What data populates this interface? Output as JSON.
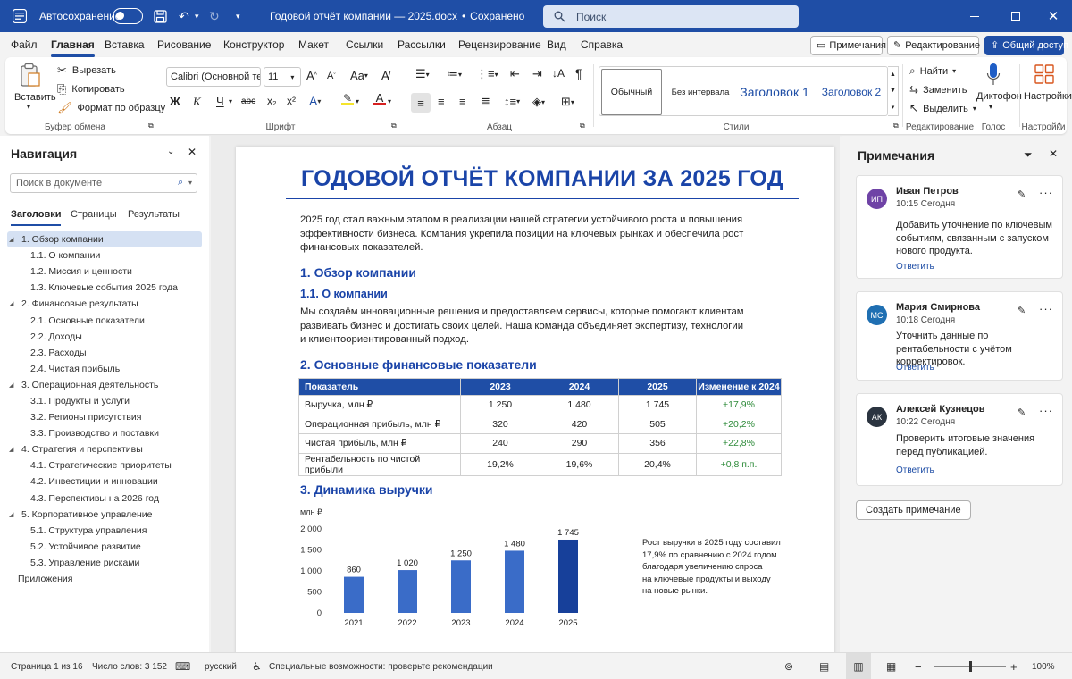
{
  "titlebar": {
    "autosave_label": "Автосохранение",
    "doc_title": "Годовой отчёт компании — 2025.docx",
    "saved_sep": "•",
    "saved_status": "Сохранено",
    "search_placeholder": "Поиск",
    "bg_color": "#1f4ea6"
  },
  "menu": {
    "tabs": [
      "Файл",
      "Главная",
      "Вставка",
      "Рисование",
      "Конструктор",
      "Макет",
      "Ссылки",
      "Рассылки",
      "Рецензирование",
      "Вид",
      "Справка"
    ],
    "active": "Главная",
    "comments_btn": "Примечания",
    "editing_btn": "Редактирование",
    "share_btn": "Общий доступ"
  },
  "ribbon": {
    "clipboard": {
      "paste": "Вставить",
      "cut": "Вырезать",
      "copy": "Копировать",
      "format_painter": "Формат по образцу",
      "label": "Буфер обмена"
    },
    "font": {
      "name": "Calibri (Основной те…",
      "size": "11",
      "bold": "Ж",
      "italic": "К",
      "underline": "Ч",
      "strike": "abc",
      "sub": "x₂",
      "sup": "x²",
      "label": "Шрифт"
    },
    "paragraph": {
      "label": "Абзац"
    },
    "styles": {
      "items": [
        "Обычный",
        "Без интервала",
        "Заголовок 1",
        "Заголовок 2"
      ],
      "label": "Стили"
    },
    "editing": {
      "find": "Найти",
      "replace": "Заменить",
      "select": "Выделить",
      "label": "Редактирование"
    },
    "voice": {
      "dictate": "Диктофон",
      "label": "Голос"
    },
    "addins": {
      "settings": "Настройки",
      "label": "Настройки"
    }
  },
  "nav": {
    "title": "Навигация",
    "search_placeholder": "Поиск в документе",
    "tabs": [
      "Заголовки",
      "Страницы",
      "Результаты"
    ],
    "tree": [
      {
        "text": "1. Обзор компании",
        "level": 1,
        "selected": true
      },
      {
        "text": "1.1. О компании",
        "level": 2
      },
      {
        "text": "1.2. Миссия и ценности",
        "level": 2
      },
      {
        "text": "1.3. Ключевые события 2025 года",
        "level": 2
      },
      {
        "text": "2. Финансовые результаты",
        "level": 1
      },
      {
        "text": "2.1. Основные показатели",
        "level": 2
      },
      {
        "text": "2.2. Доходы",
        "level": 2
      },
      {
        "text": "2.3. Расходы",
        "level": 2
      },
      {
        "text": "2.4. Чистая прибыль",
        "level": 2
      },
      {
        "text": "3. Операционная деятельность",
        "level": 1
      },
      {
        "text": "3.1. Продукты и услуги",
        "level": 2
      },
      {
        "text": "3.2. Регионы присутствия",
        "level": 2
      },
      {
        "text": "3.3. Производство и поставки",
        "level": 2
      },
      {
        "text": "4. Стратегия и перспективы",
        "level": 1
      },
      {
        "text": "4.1. Стратегические приоритеты",
        "level": 2
      },
      {
        "text": "4.2. Инвестиции и инновации",
        "level": 2
      },
      {
        "text": "4.3. Перспективы на 2026 год",
        "level": 2
      },
      {
        "text": "5. Корпоративное управление",
        "level": 1
      },
      {
        "text": "5.1. Структура управления",
        "level": 2
      },
      {
        "text": "5.2. Устойчивое развитие",
        "level": 2
      },
      {
        "text": "5.3. Управление рисками",
        "level": 2
      },
      {
        "text": "Приложения",
        "level": 0
      }
    ]
  },
  "doc": {
    "title": "ГОДОВОЙ ОТЧЁТ КОМПАНИИ ЗА 2025 ГОД",
    "intro_lines": [
      "2025 год стал важным этапом в реализации нашей стратегии устойчивого роста и повышения",
      "эффективности бизнеса. Компания укрепила позиции на ключевых рынках и обеспечила рост",
      "финансовых показателей."
    ],
    "h_overview": "1. Обзор компании",
    "h_about": "1.1. О компании",
    "about_lines": [
      "Мы создаём инновационные решения и предоставляем сервисы, которые помогают клиентам",
      "развивать бизнес и достигать своих целей. Наша команда объединяет экспертизу, технологии",
      "и клиентоориентированный подход."
    ],
    "h_fin": "2. Основные финансовые показатели",
    "table": {
      "headers": [
        "Показатель",
        "2023",
        "2024",
        "2025",
        "Изменение к 2024"
      ],
      "rows": [
        [
          "Выручка, млн ₽",
          "1 250",
          "1 480",
          "1 745",
          "+17,9%"
        ],
        [
          "Операционная прибыль, млн ₽",
          "320",
          "420",
          "505",
          "+20,2%"
        ],
        [
          "Чистая прибыль, млн ₽",
          "240",
          "290",
          "356",
          "+22,8%"
        ],
        [
          "Рентабельность по чистой прибыли",
          "19,2%",
          "19,6%",
          "20,4%",
          "+0,8 п.п."
        ]
      ]
    },
    "h_dyn": "3. Динамика выручки",
    "chart_note_lines": [
      "Рост выручки в 2025 году составил",
      "17,9% по сравнению с 2024 годом",
      "благодаря увеличению спроса",
      "на ключевые продукты и выходу",
      "на новые рынки."
    ]
  },
  "chart_data": {
    "type": "bar",
    "ylabel": "млн ₽",
    "categories": [
      "2021",
      "2022",
      "2023",
      "2024",
      "2025"
    ],
    "values": [
      860,
      1020,
      1250,
      1480,
      1745
    ],
    "value_labels": [
      "860",
      "1 020",
      "1 250",
      "1 480",
      "1 745"
    ],
    "ylim": [
      0,
      2000
    ],
    "yticks": [
      0,
      500,
      1000,
      1500,
      2000
    ],
    "ytick_labels": [
      "0",
      "500",
      "1 000",
      "1 500",
      "2 000"
    ],
    "colors": {
      "bar": "#3a6cc8",
      "last_bar": "#17409a"
    },
    "grid": false
  },
  "comments": {
    "title": "Примечания",
    "items": [
      {
        "initials": "ИП",
        "author": "Иван Петров",
        "time": "10:15 Сегодня",
        "text": "Добавить уточнение по ключевым событиям, связанным с запуском нового продукта.",
        "reply": "Ответить",
        "color": "#6f43a6"
      },
      {
        "initials": "МС",
        "author": "Мария Смирнова",
        "time": "10:18 Сегодня",
        "text": "Уточнить данные по рентабельности с учётом корректировок.",
        "reply": "Ответить",
        "color": "#1f6fb2"
      },
      {
        "initials": "АК",
        "author": "Алексей Кузнецов",
        "time": "10:22 Сегодня",
        "text": "Проверить итоговые значения перед публикацией.",
        "reply": "Ответить",
        "color": "#2b3440"
      }
    ],
    "new_comment": "Создать примечание"
  },
  "status": {
    "page": "Страница 1 из 16",
    "words": "Число слов: 3 152",
    "lang": "русский",
    "accessibility": "Специальные возможности: проверьте рекомендации",
    "zoom": "100%",
    "zoom_level": 0.5
  }
}
